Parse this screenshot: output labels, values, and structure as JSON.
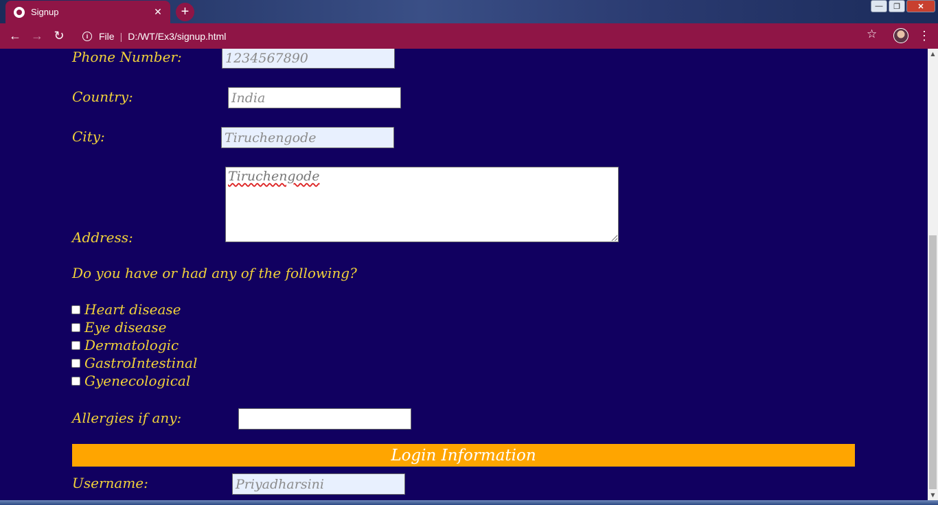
{
  "browser": {
    "tab_title": "Signup",
    "tab_close": "✕",
    "new_tab": "+",
    "back": "←",
    "forward": "→",
    "reload": "↻",
    "info": "i",
    "scheme": "File",
    "separator": "|",
    "url": "D:/WT/Ex3/signup.html",
    "star": "☆",
    "menu": "⋮",
    "window": {
      "minimize": "—",
      "restore": "❐",
      "close": "✕"
    }
  },
  "form": {
    "phone": {
      "label": "Phone Number:",
      "value": "1234567890"
    },
    "country": {
      "label": "Country:",
      "value": "India"
    },
    "city": {
      "label": "City:",
      "value": "Tiruchengode"
    },
    "address": {
      "label": "Address:",
      "value": "Tiruchengode"
    },
    "question": "Do you have or had any of the following?",
    "conditions": [
      {
        "label": "Heart disease",
        "checked": false
      },
      {
        "label": "Eye disease",
        "checked": false
      },
      {
        "label": "Dermatologic",
        "checked": false
      },
      {
        "label": "GastroIntestinal",
        "checked": false
      },
      {
        "label": "Gyenecological",
        "checked": false
      }
    ],
    "allergies": {
      "label": "Allergies if any:",
      "value": ""
    },
    "login_section": "Login Information",
    "username": {
      "label": "Username:",
      "value": "Priyadharsini"
    }
  },
  "scroll": {
    "up": "▲",
    "down": "▼"
  },
  "colors": {
    "page_bg": "#110060",
    "label_text": "#f2d23a",
    "section_bar": "#ffa500",
    "browser_accent": "#8f1546"
  }
}
